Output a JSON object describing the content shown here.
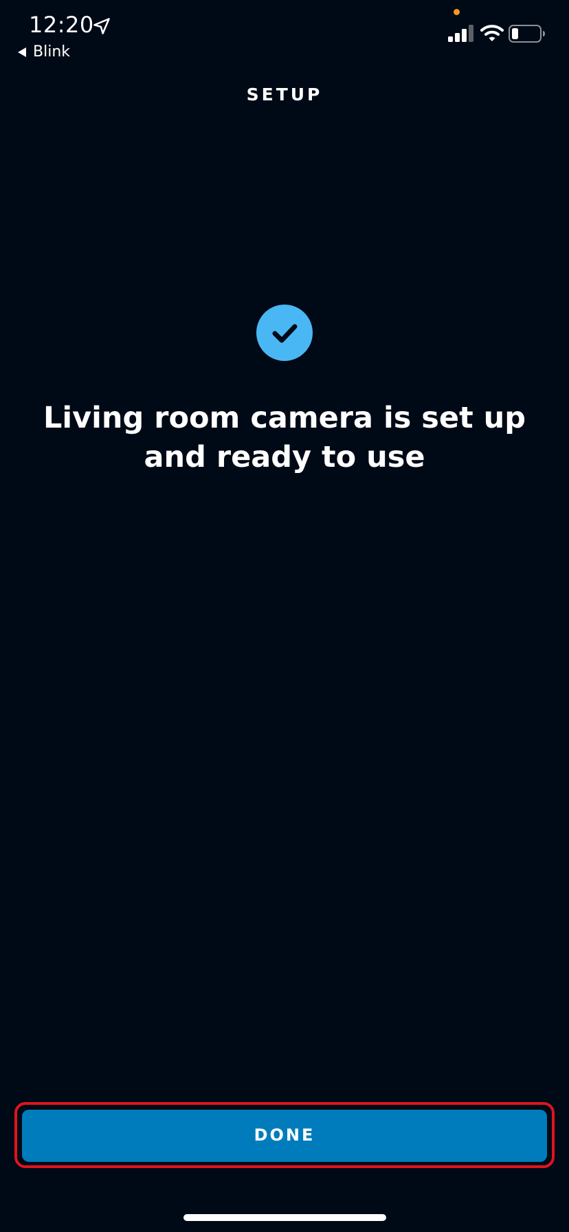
{
  "status_bar": {
    "time": "12:20",
    "back_app": "Blink",
    "privacy_dot_color": "#f29a1f",
    "signal_strength": "3 of 4 bars",
    "battery_level": 0.2,
    "icons": [
      "location-arrow-icon",
      "back-arrow-icon",
      "signal-icon",
      "wifi-icon",
      "battery-icon"
    ]
  },
  "header": {
    "title": "SETUP"
  },
  "main": {
    "icon": "check-circle-icon",
    "message": "Living room camera is set up and ready to use"
  },
  "footer": {
    "done_label": "DONE"
  },
  "colors": {
    "background": "#000a16",
    "accent": "#4ab7f5",
    "button": "#007cbd",
    "highlight": "#e0141e"
  }
}
